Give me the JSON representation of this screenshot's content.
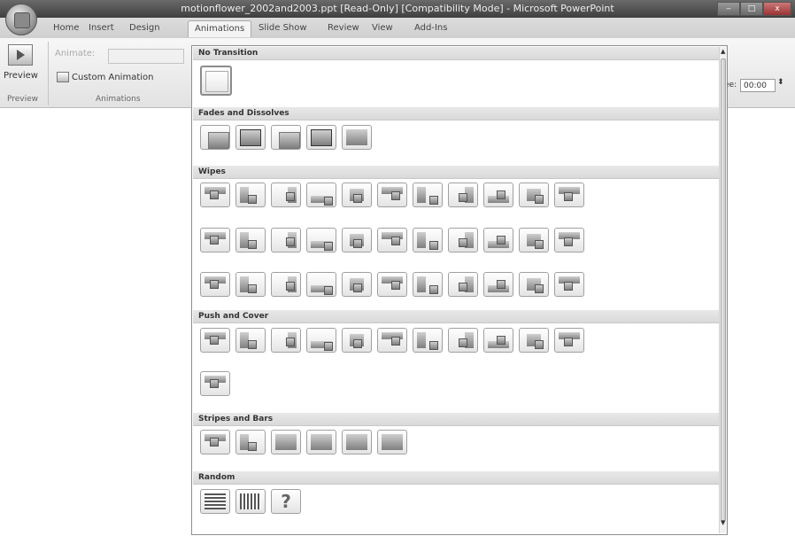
{
  "window": {
    "title": "motionflower_2002and2003.ppt [Read-Only] [Compatibility Mode] - Microsoft PowerPoint",
    "controls": [
      "‒",
      "□",
      "x"
    ]
  },
  "tabs": [
    {
      "label": "Home"
    },
    {
      "label": "Insert"
    },
    {
      "label": "Design"
    },
    {
      "label": "Animations"
    },
    {
      "label": "Slide Show"
    },
    {
      "label": "Review"
    },
    {
      "label": "View"
    },
    {
      "label": "Add-Ins"
    }
  ],
  "ribbon": {
    "preview_button": "Preview",
    "preview_group": "Preview",
    "animate_label": "Animate:",
    "custom_animation": "Custom Animation",
    "animations_group": "Animations",
    "speed_label_fragment": "ee:",
    "time_value": "00:00"
  },
  "gallery": {
    "sections": [
      {
        "title": "No Transition"
      },
      {
        "title": "Fades and Dissolves"
      },
      {
        "title": "Wipes"
      },
      {
        "title": "Push and Cover"
      },
      {
        "title": "Stripes and Bars"
      },
      {
        "title": "Random"
      }
    ],
    "random_tile_glyph": "?"
  },
  "icons": {
    "office_button": "office-button-icon",
    "preview": "preview-icon",
    "custom_animation": "custom-animation-icon"
  },
  "colors": {
    "titlebar": "#4a4a4a",
    "ribbon": "#ececec",
    "gallery_header": "#e0e0e0"
  }
}
